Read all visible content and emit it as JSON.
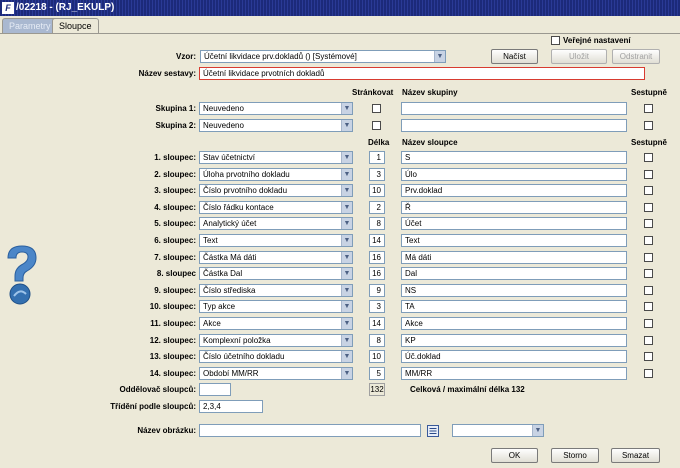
{
  "window": {
    "title": "/02218 - (RJ_EKULP)"
  },
  "tabs": [
    {
      "label": "Parametry",
      "active": false
    },
    {
      "label": "Sloupce",
      "active": true
    }
  ],
  "header": {
    "public_label": "Veřejné nastavení",
    "template_label": "Vzor:",
    "template_value": "Účetní likvidace prv.dokladů   ()   [Systémové]",
    "load_button": "Načíst",
    "save_button": "Uložit",
    "remove_button": "Odstranit",
    "report_name_label": "Název sestavy:",
    "report_name_value": "Účetní likvidace prvotních dokladů"
  },
  "groups": {
    "col_page": "Stránkovat",
    "col_name": "Název skupiny",
    "col_desc": "Sestupně",
    "rows": [
      {
        "label": "Skupina 1:",
        "value": "Neuvedeno",
        "name": ""
      },
      {
        "label": "Skupina 2:",
        "value": "Neuvedeno",
        "name": ""
      }
    ]
  },
  "columns": {
    "col_length": "Délka",
    "col_name": "Název sloupce",
    "col_desc": "Sestupně",
    "rows": [
      {
        "label": "1. sloupec:",
        "value": "Stav účetnictví",
        "length": "1",
        "name": "S"
      },
      {
        "label": "2. sloupec:",
        "value": "Úloha prvotního dokladu",
        "length": "3",
        "name": "Úlo"
      },
      {
        "label": "3. sloupec:",
        "value": "Číslo prvotního dokladu",
        "length": "10",
        "name": "Prv.doklad"
      },
      {
        "label": "4. sloupec:",
        "value": "Číslo řádku kontace",
        "length": "2",
        "name": "Ř"
      },
      {
        "label": "5. sloupec:",
        "value": "Analytický účet",
        "length": "8",
        "name": "Účet"
      },
      {
        "label": "6. sloupec:",
        "value": "Text",
        "length": "14",
        "name": "Text"
      },
      {
        "label": "7. sloupec:",
        "value": "Částka Má dáti",
        "length": "16",
        "name": "Má dáti"
      },
      {
        "label": "8. sloupec",
        "value": "Částka Dal",
        "length": "16",
        "name": "Dal"
      },
      {
        "label": "9. sloupec:",
        "value": "Číslo střediska",
        "length": "9",
        "name": "NS"
      },
      {
        "label": "10. sloupec:",
        "value": "Typ akce",
        "length": "3",
        "name": "TA"
      },
      {
        "label": "11. sloupec:",
        "value": "Akce",
        "length": "14",
        "name": "Akce"
      },
      {
        "label": "12. sloupec:",
        "value": "Komplexní položka",
        "length": "8",
        "name": "KP"
      },
      {
        "label": "13. sloupec:",
        "value": "Číslo účetního dokladu",
        "length": "10",
        "name": "Úč.doklad"
      },
      {
        "label": "14. sloupec:",
        "value": "Období MM/RR",
        "length": "5",
        "name": "MM/RR"
      }
    ]
  },
  "footer": {
    "separator_label": "Oddělovač sloupců:",
    "separator_value": "",
    "total_length": "132",
    "total_text": "Celková / maximální délka 132",
    "sort_label": "Třídění podle sloupců:",
    "sort_value": "2,3,4",
    "image_label": "Název obrázku:",
    "image_value": "",
    "image_select_value": "",
    "ok_button": "OK",
    "cancel_button": "Storno",
    "delete_button": "Smazat"
  }
}
